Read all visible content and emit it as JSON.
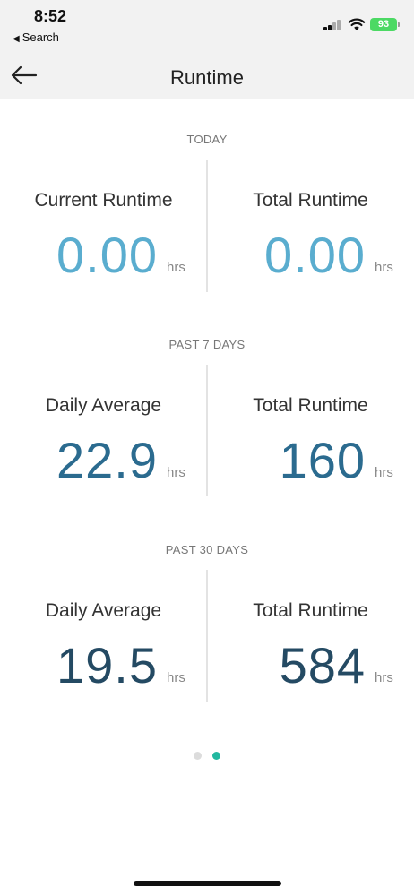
{
  "status_bar": {
    "time": "8:52",
    "back_label": "Search",
    "battery": "93"
  },
  "header": {
    "title": "Runtime"
  },
  "sections": [
    {
      "label": "TODAY",
      "left": {
        "label": "Current Runtime",
        "value": "0.00",
        "unit": "hrs"
      },
      "right": {
        "label": "Total Runtime",
        "value": "0.00",
        "unit": "hrs"
      }
    },
    {
      "label": "PAST 7 DAYS",
      "left": {
        "label": "Daily Average",
        "value": "22.9",
        "unit": "hrs"
      },
      "right": {
        "label": "Total Runtime",
        "value": "160",
        "unit": "hrs"
      }
    },
    {
      "label": "PAST 30 DAYS",
      "left": {
        "label": "Daily Average",
        "value": "19.5",
        "unit": "hrs"
      },
      "right": {
        "label": "Total Runtime",
        "value": "584",
        "unit": "hrs"
      }
    }
  ],
  "pagination": {
    "pages": 2,
    "current": 2
  },
  "colors": {
    "today_value": "#5aadcf",
    "week_value": "#2b6b8f",
    "month_value": "#244a63",
    "active_dot": "#22b8a0",
    "inactive_dot": "#dcdcdc"
  }
}
